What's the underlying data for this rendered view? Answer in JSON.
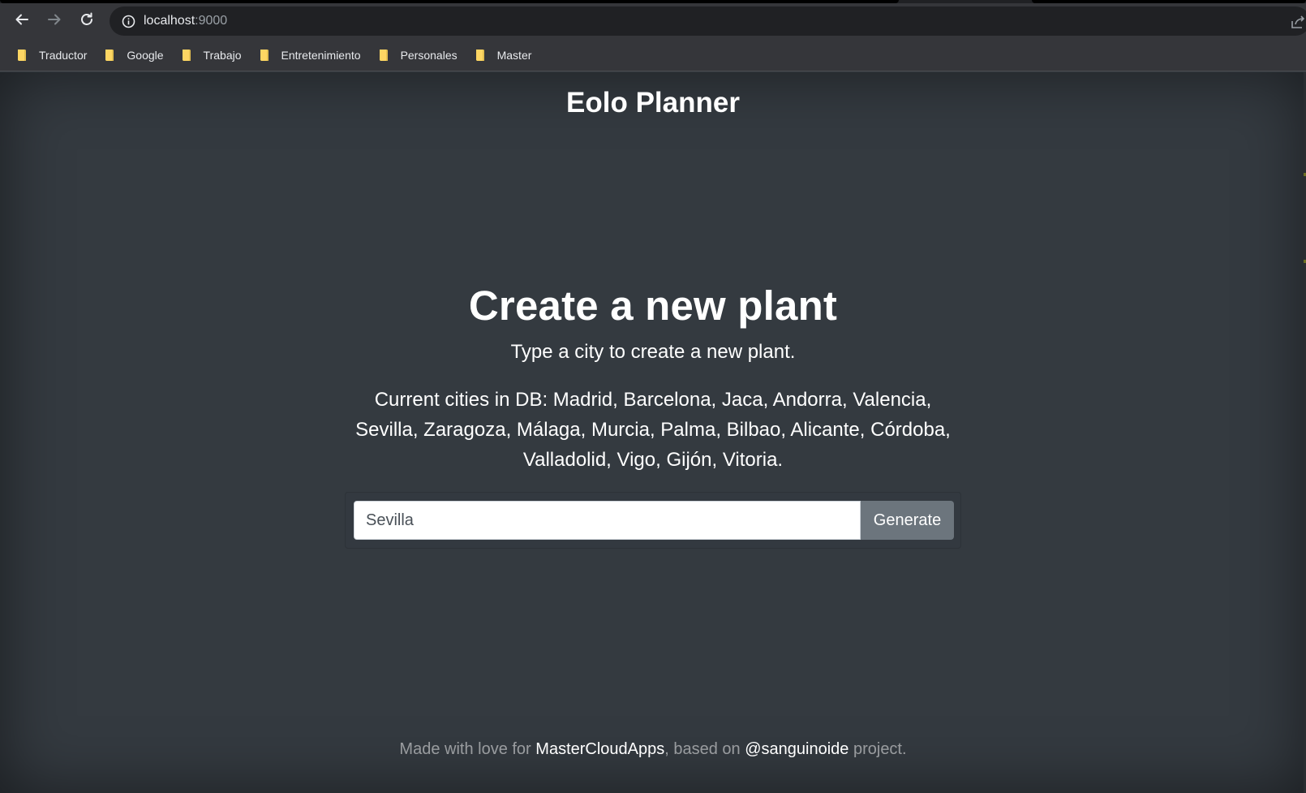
{
  "browser": {
    "url_host": "localhost",
    "url_port": ":9000",
    "bookmarks": [
      {
        "label": "Traductor"
      },
      {
        "label": "Google"
      },
      {
        "label": "Trabajo"
      },
      {
        "label": "Entretenimiento"
      },
      {
        "label": "Personales"
      },
      {
        "label": "Master"
      }
    ],
    "icons": {
      "back": "arrow-left-icon",
      "forward": "arrow-right-icon",
      "reload": "reload-icon",
      "info": "info-icon",
      "share": "share-icon",
      "folder": "folder-icon"
    },
    "folder_color": "#fdd663"
  },
  "site": {
    "brand": "Eolo Planner"
  },
  "main": {
    "heading": "Create a new plant",
    "lead": "Type a city to create a new plant.",
    "cities_text": "Current cities in DB: Madrid, Barcelona, Jaca, Andorra, Valencia, Sevilla, Zaragoza, Málaga, Murcia, Palma, Bilbao, Alicante, Córdoba, Valladolid, Vigo, Gijón, Vitoria."
  },
  "form": {
    "city_value": "Sevilla",
    "generate_label": "Generate"
  },
  "footer": {
    "prefix": "Made with love for ",
    "link1": "MasterCloudApps",
    "middle": ", based on ",
    "link2": "@sanguinoide",
    "suffix": " project."
  },
  "colors": {
    "page_bg": "#343a40",
    "button_bg": "#6c757d",
    "chrome_bg": "#35363a"
  }
}
